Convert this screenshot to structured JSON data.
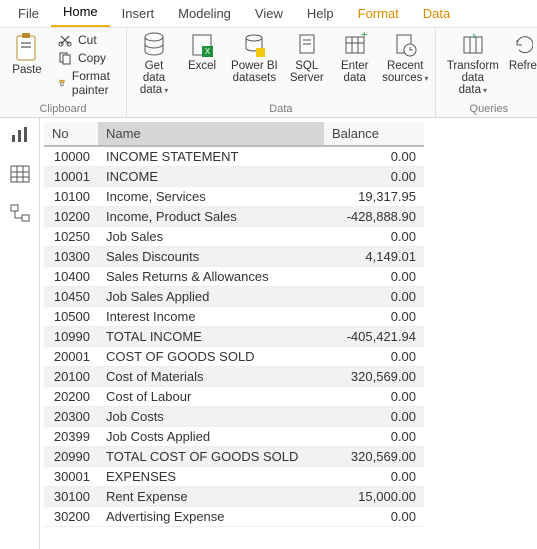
{
  "menubar": {
    "items": [
      "File",
      "Home",
      "Insert",
      "Modeling",
      "View",
      "Help",
      "Format",
      "Data"
    ],
    "active": "Home",
    "highlight": [
      "Format",
      "Data"
    ]
  },
  "ribbon": {
    "clipboard": {
      "label": "Clipboard",
      "paste": "Paste",
      "cut": "Cut",
      "copy": "Copy",
      "format_painter": "Format painter"
    },
    "data": {
      "label": "Data",
      "get_data": "Get data",
      "excel": "Excel",
      "pbi_datasets": "Power BI datasets",
      "sql_server": "SQL Server",
      "enter_data": "Enter data",
      "recent_sources": "Recent sources"
    },
    "queries": {
      "label": "Queries",
      "transform_data": "Transform data",
      "refresh": "Refre"
    }
  },
  "table": {
    "columns": {
      "no": "No",
      "name": "Name",
      "balance": "Balance"
    },
    "rows": [
      {
        "no": "10000",
        "name": "INCOME STATEMENT",
        "balance": "0.00"
      },
      {
        "no": "10001",
        "name": "INCOME",
        "balance": "0.00"
      },
      {
        "no": "10100",
        "name": "Income, Services",
        "balance": "19,317.95"
      },
      {
        "no": "10200",
        "name": "Income, Product Sales",
        "balance": "-428,888.90"
      },
      {
        "no": "10250",
        "name": "Job Sales",
        "balance": "0.00"
      },
      {
        "no": "10300",
        "name": "Sales Discounts",
        "balance": "4,149.01"
      },
      {
        "no": "10400",
        "name": "Sales Returns & Allowances",
        "balance": "0.00"
      },
      {
        "no": "10450",
        "name": "Job Sales Applied",
        "balance": "0.00"
      },
      {
        "no": "10500",
        "name": "Interest Income",
        "balance": "0.00"
      },
      {
        "no": "10990",
        "name": "TOTAL INCOME",
        "balance": "-405,421.94"
      },
      {
        "no": "20001",
        "name": "COST OF GOODS SOLD",
        "balance": "0.00"
      },
      {
        "no": "20100",
        "name": "Cost of Materials",
        "balance": "320,569.00"
      },
      {
        "no": "20200",
        "name": "Cost of Labour",
        "balance": "0.00"
      },
      {
        "no": "20300",
        "name": "Job Costs",
        "balance": "0.00"
      },
      {
        "no": "20399",
        "name": "Job Costs Applied",
        "balance": "0.00"
      },
      {
        "no": "20990",
        "name": "TOTAL COST OF GOODS SOLD",
        "balance": "320,569.00"
      },
      {
        "no": "30001",
        "name": "EXPENSES",
        "balance": "0.00"
      },
      {
        "no": "30100",
        "name": "Rent Expense",
        "balance": "15,000.00"
      },
      {
        "no": "30200",
        "name": "Advertising Expense",
        "balance": "0.00"
      }
    ]
  }
}
